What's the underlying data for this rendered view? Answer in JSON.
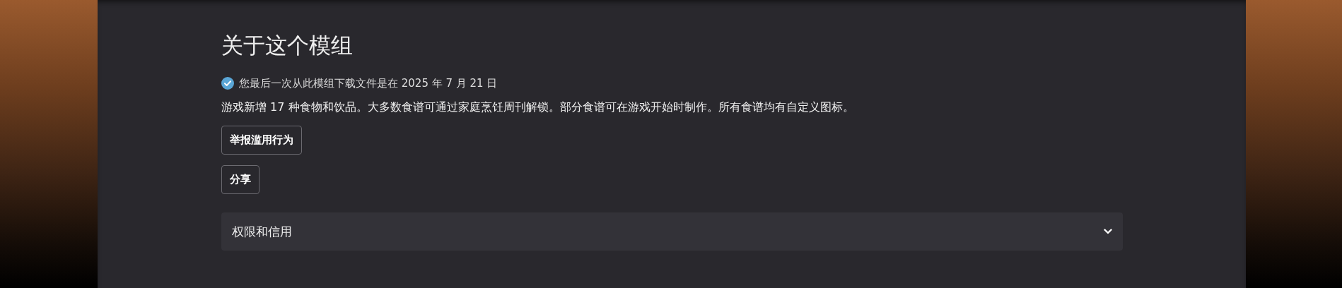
{
  "section": {
    "title": "关于这个模组",
    "download_notice": {
      "checked": true,
      "text": "您最后一次从此模组下载文件是在 2025 年 7 月 21 日"
    },
    "description": "游戏新增 17 种食物和饮品。大多数食谱可通过家庭烹饪周刊解锁。部分食谱可在游戏开始时制作。所有食谱均有自定义图标。",
    "buttons": [
      "举报滥用行为",
      "分享"
    ],
    "accordion": {
      "label": "权限和信用",
      "expanded": false
    }
  }
}
